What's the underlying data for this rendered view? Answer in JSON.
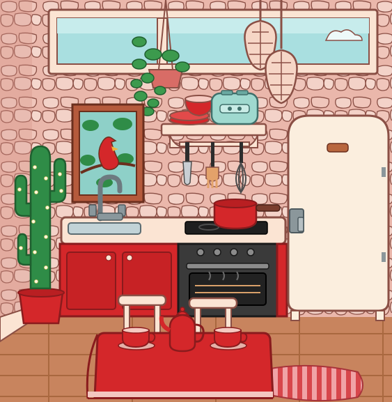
{
  "scene": {
    "name": "kitchen-room",
    "palette": {
      "wall_pink": "#eab7ab",
      "stone": "#f3d2c8",
      "stone_line": "#8a4f45",
      "red": "#d4272a",
      "red_dark": "#9f1b1d",
      "counter": "#fbe4d3",
      "fridge": "#fbeede",
      "floor": "#c8845e",
      "floor_line": "#a9683f",
      "green": "#2f8c47",
      "mint": "#9fd9cf",
      "sky": "#a9dfe0"
    },
    "items": [
      "window",
      "hanging-plant",
      "pendant-lamp-left",
      "pendant-lamp-right",
      "cardinal-painting",
      "wall-shelf",
      "toaster",
      "bowl-stack",
      "kitchen-knife",
      "fork-utensil",
      "whisk",
      "sink-faucet",
      "stovetop",
      "red-saucepan",
      "oven",
      "red-cabinets",
      "refrigerator",
      "cactus-with-lights",
      "dining-table",
      "teapot",
      "teacups",
      "chairs",
      "rug"
    ]
  }
}
